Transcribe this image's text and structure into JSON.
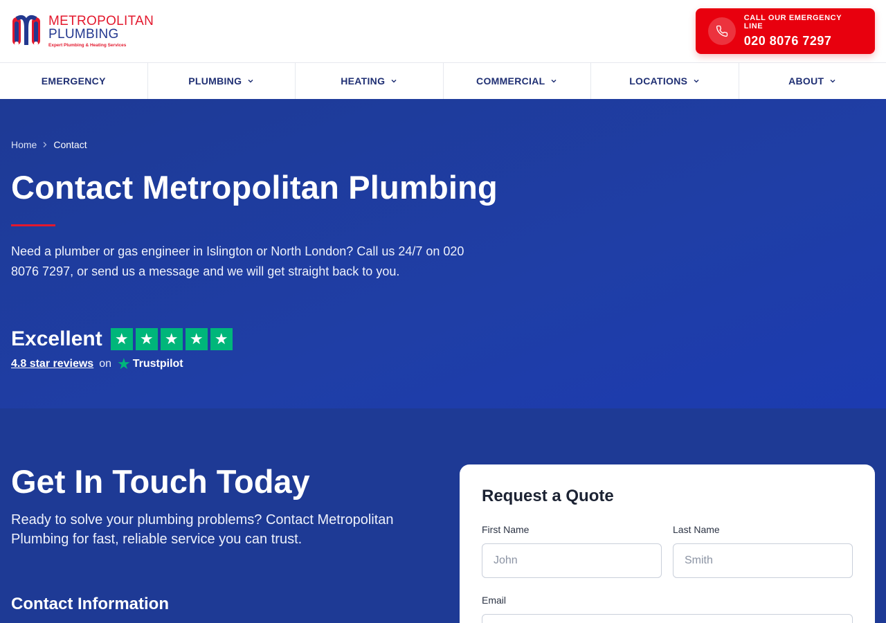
{
  "header": {
    "logo": {
      "line1": "METROPOLITAN",
      "line2": "PLUMBING",
      "tagline": "Expert Plumbing & Heating Services"
    },
    "emergency": {
      "label": "CALL OUR EMERGENCY LINE",
      "number": "020 8076 7297"
    }
  },
  "nav": {
    "items": [
      {
        "label": "EMERGENCY",
        "dropdown": false
      },
      {
        "label": "PLUMBING",
        "dropdown": true
      },
      {
        "label": "HEATING",
        "dropdown": true
      },
      {
        "label": "COMMERCIAL",
        "dropdown": true
      },
      {
        "label": "LOCATIONS",
        "dropdown": true
      },
      {
        "label": "ABOUT",
        "dropdown": true
      }
    ]
  },
  "hero": {
    "breadcrumb": {
      "home": "Home",
      "current": "Contact"
    },
    "title": "Contact Metropolitan Plumbing",
    "description": "Need a plumber or gas engineer in Islington or North London? Call us 24/7 on 020 8076 7297, or send us a message and we will get straight back to you.",
    "trustpilot": {
      "rating_word": "Excellent",
      "stars": 5,
      "reviews_link": "4.8 star reviews",
      "on": "on",
      "brand": "Trustpilot"
    }
  },
  "contact": {
    "title": "Get In Touch Today",
    "description": "Ready to solve your plumbing problems? Contact Metropolitan Plumbing for fast, reliable service you can trust.",
    "info_title": "Contact Information",
    "form": {
      "title": "Request a Quote",
      "first_name": {
        "label": "First Name",
        "placeholder": "John"
      },
      "last_name": {
        "label": "Last Name",
        "placeholder": "Smith"
      },
      "email": {
        "label": "Email"
      }
    }
  },
  "colors": {
    "brand_red": "#e8000e",
    "brand_blue": "#1e3a95",
    "trustpilot_green": "#00b67a"
  }
}
